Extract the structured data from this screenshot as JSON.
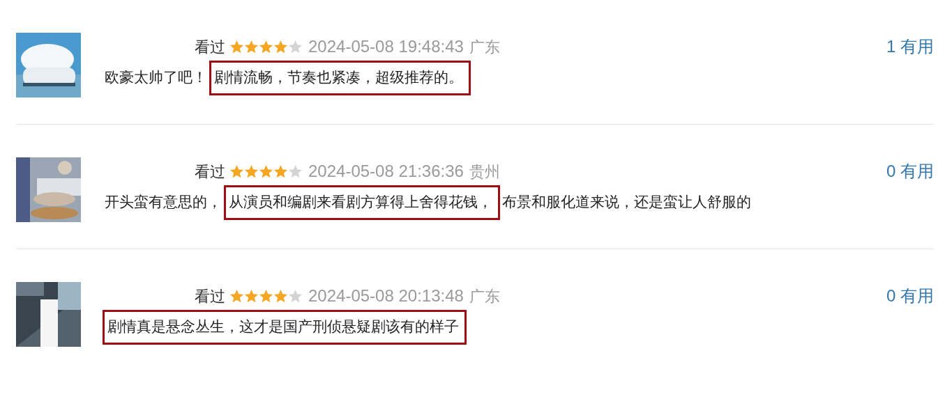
{
  "reviews": [
    {
      "avatar": {
        "kind": "picture"
      },
      "watched": "看过",
      "stars": 4,
      "time": "2024-05-08 19:48:43",
      "region": "广东",
      "useful_count": "1",
      "useful_label": "有用",
      "comment": [
        {
          "text": "欧豪太帅了吧！",
          "highlighted": false
        },
        {
          "text": "剧情流畅，节奏也紧凑，超级推荐的。",
          "highlighted": true
        }
      ]
    },
    {
      "avatar": {
        "kind": "picture"
      },
      "watched": "看过",
      "stars": 4,
      "time": "2024-05-08 21:36:36",
      "region": "贵州",
      "useful_count": "0",
      "useful_label": "有用",
      "comment": [
        {
          "text": "开头蛮有意思的，",
          "highlighted": false
        },
        {
          "text": "从演员和编剧来看剧方算得上舍得花钱，",
          "highlighted": true
        },
        {
          "text": "布景和服化道来说，还是蛮让人舒服的",
          "highlighted": false
        }
      ]
    },
    {
      "avatar": {
        "kind": "picture"
      },
      "watched": "看过",
      "stars": 4,
      "time": "2024-05-08 20:13:48",
      "region": "广东",
      "useful_count": "0",
      "useful_label": "有用",
      "comment": [
        {
          "text": "剧情真是悬念丛生，这才是国产刑侦悬疑剧该有的样子",
          "highlighted": true
        }
      ]
    }
  ]
}
